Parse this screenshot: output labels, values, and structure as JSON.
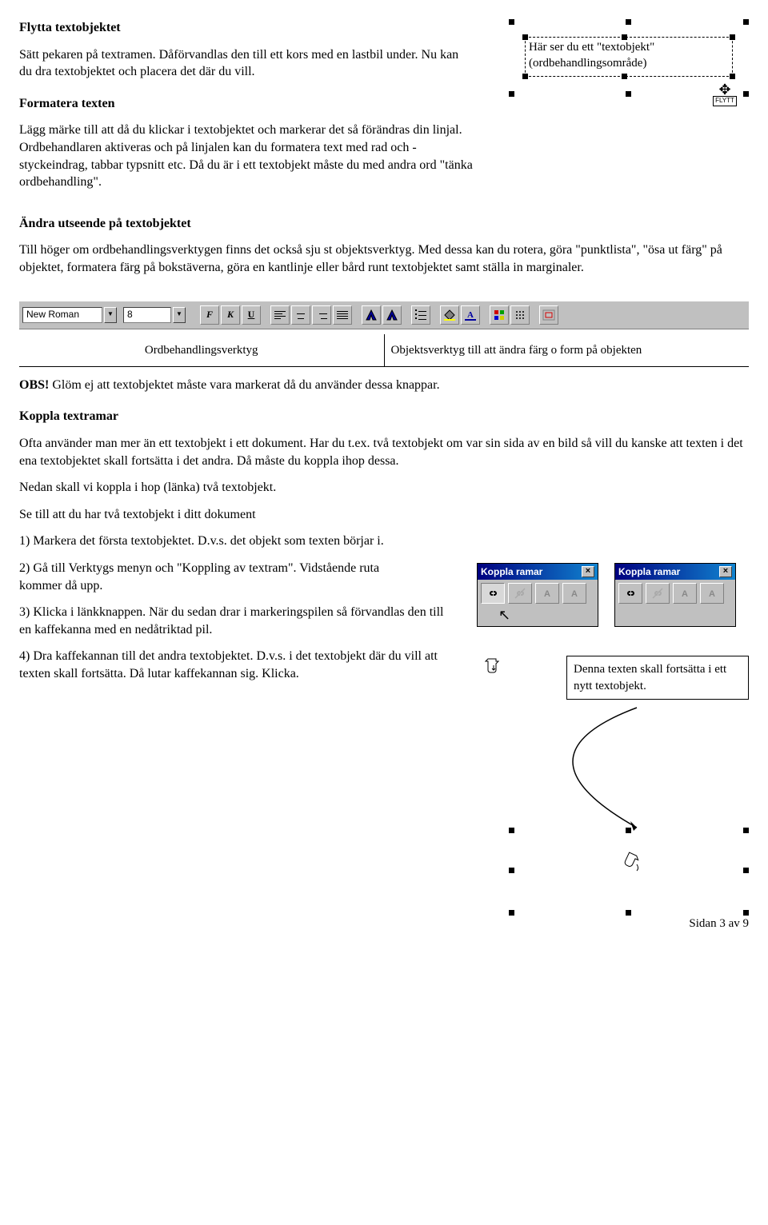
{
  "headings": {
    "h1": "Flytta textobjektet",
    "h2": "Formatera texten",
    "h3": "Ändra utseende på textobjektet",
    "h4": "Koppla textramar"
  },
  "paras": {
    "p1": "Sätt pekaren på textramen. Dåförvandlas den till ett kors med en lastbil under. Nu kan du dra textobjektet och placera det där du vill.",
    "p2": "Lägg märke till att då du klickar i textobjektet och markerar det så förändras din linjal. Ordbehandlaren aktiveras och på linjalen kan du formatera text med rad och -styckeindrag, tabbar typsnitt etc. Då du är i ett textobjekt måste du med andra ord \"tänka ordbehandling\".",
    "p3": "Till höger om ordbehandlingsverktygen finns det också sju st objektsverktyg. Med dessa kan du rotera, göra \"punktlista\", \"ösa ut färg\" på objektet, formatera färg på bokstäverna, göra en kantlinje eller bård runt textobjektet samt ställa in marginaler.",
    "obs_label": "OBS!",
    "obs_rest": " Glöm ej att textobjektet måste vara markerat då du använder dessa knappar.",
    "p5": "Ofta använder man mer än ett textobjekt i ett dokument. Har du t.ex. två textobjekt om var sin sida av en bild så vill du kanske att texten i det ena textobjektet skall fortsätta i det andra. Då måste du koppla ihop dessa.",
    "p6": "Nedan skall vi koppla i hop (länka) två textobjekt.",
    "p7": "Se till att du har två textobjekt i ditt dokument",
    "p8": "1) Markera det första textobjektet. D.v.s. det objekt som texten börjar i.",
    "p9": "2) Gå till Verktygs menyn och \"Koppling av textram\". Vidstående ruta kommer då upp.",
    "p10": "3) Klicka i länkknappen. När du sedan drar i markeringspilen så förvandlas den till en kaffekanna med en nedåtriktad pil.",
    "p11": "4) Dra kaffekannan till det andra textobjektet. D.v.s. i det textobjekt där du vill att texten skall fortsätta. Då lutar kaffekannan sig. Klicka."
  },
  "preview": {
    "line1": "Här ser du ett \"textobjekt\"",
    "line2": "(ordbehandlingsområde)",
    "flytt": "FLYTT"
  },
  "toolbar": {
    "font": "New Roman",
    "size": "8",
    "bold": "F",
    "italic": "K",
    "underline": "U"
  },
  "labels": {
    "left": "Ordbehandlingsverktyg",
    "right": "Objektsverktyg till att ändra färg o form på objekten"
  },
  "palette": {
    "title": "Koppla ramar",
    "title2": "Koppla ramar"
  },
  "linkbox": {
    "text": "Denna texten skall fortsätta i ett nytt textobjekt."
  },
  "footer": "Sidan 3 av 9"
}
